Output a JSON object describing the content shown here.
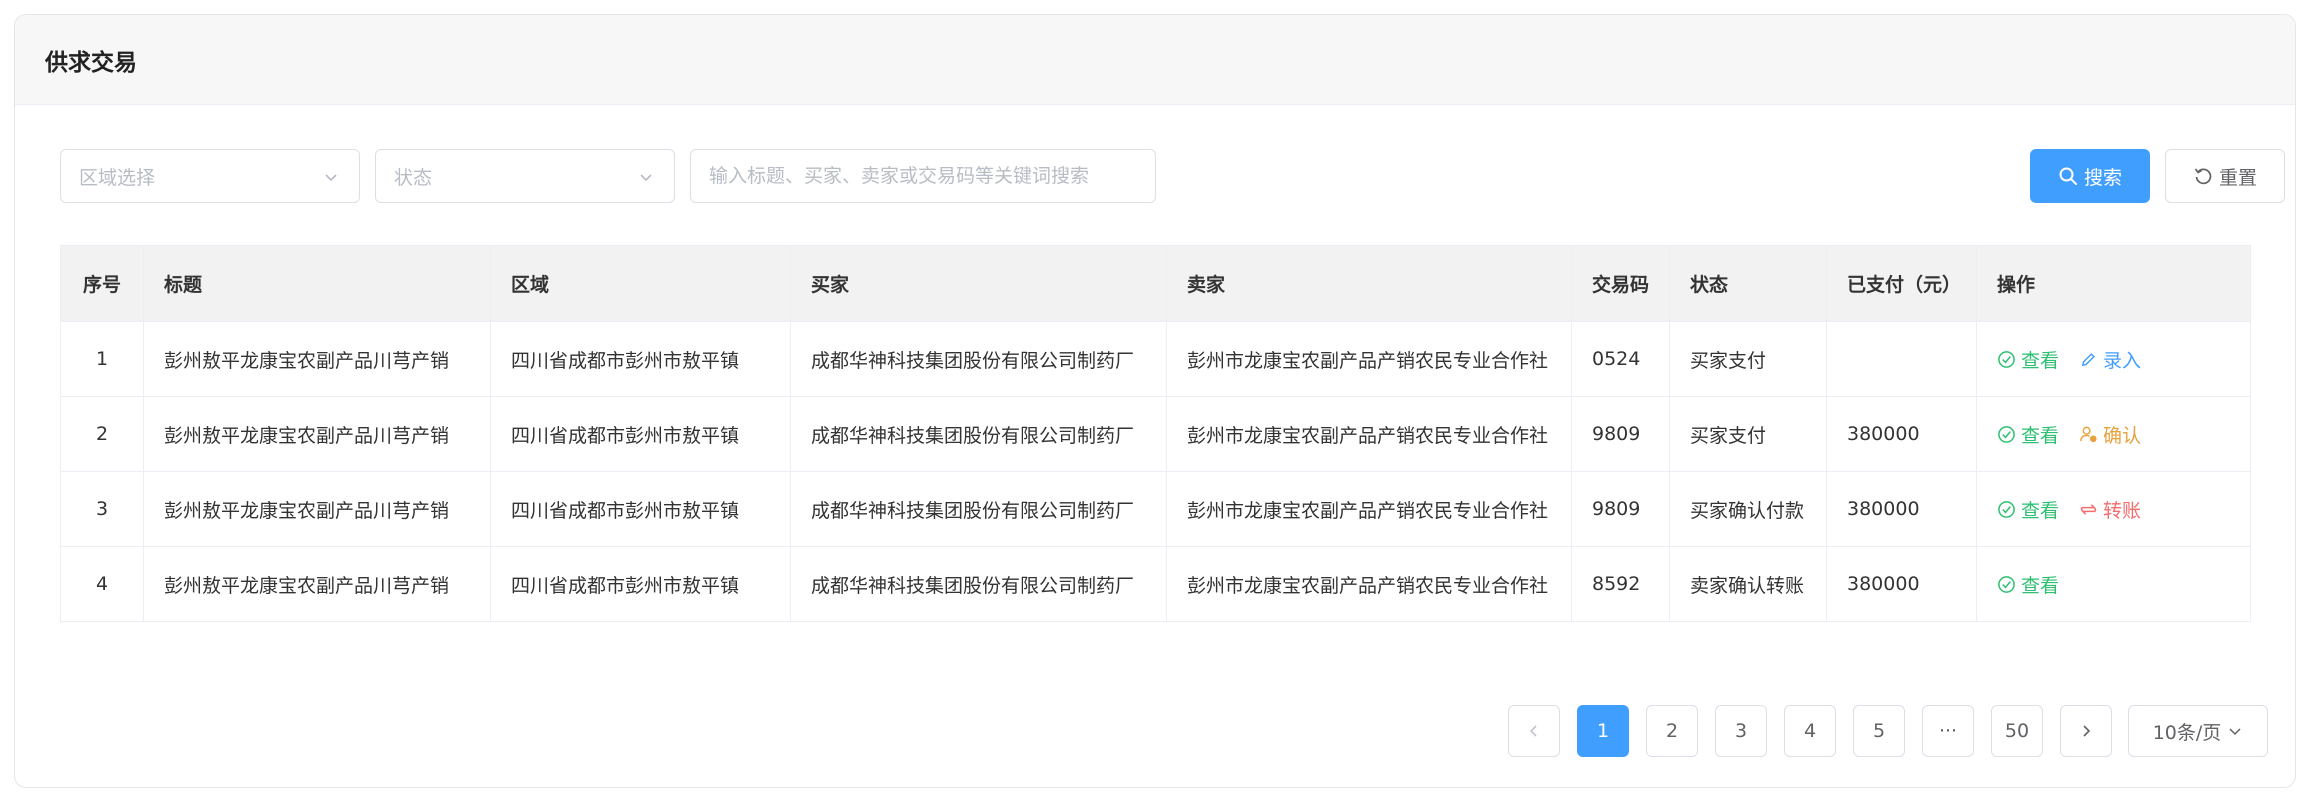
{
  "page": {
    "title": "供求交易"
  },
  "filters": {
    "region_placeholder": "区域选择",
    "status_placeholder": "状态",
    "keyword_placeholder": "输入标题、买家、卖家或交易码等关键词搜索",
    "search_label": "搜索",
    "reset_label": "重置"
  },
  "table": {
    "headers": {
      "index": "序号",
      "title": "标题",
      "region": "区域",
      "buyer": "买家",
      "seller": "卖家",
      "code": "交易码",
      "status": "状态",
      "paid": "已支付（元）",
      "ops": "操作"
    },
    "rows": [
      {
        "index": "1",
        "title": "彭州敖平龙康宝农副产品川芎产销",
        "region": "四川省成都市彭州市敖平镇",
        "buyer": "成都华神科技集团股份有限公司制药厂",
        "seller": "彭州市龙康宝农副产品产销农民专业合作社",
        "code": "0524",
        "status": "买家支付",
        "paid": "",
        "view": "查看",
        "action": "录入",
        "action_type": "edit"
      },
      {
        "index": "2",
        "title": "彭州敖平龙康宝农副产品川芎产销",
        "region": "四川省成都市彭州市敖平镇",
        "buyer": "成都华神科技集团股份有限公司制药厂",
        "seller": "彭州市龙康宝农副产品产销农民专业合作社",
        "code": "9809",
        "status": "买家支付",
        "paid": "380000",
        "view": "查看",
        "action": "确认",
        "action_type": "confirm"
      },
      {
        "index": "3",
        "title": "彭州敖平龙康宝农副产品川芎产销",
        "region": "四川省成都市彭州市敖平镇",
        "buyer": "成都华神科技集团股份有限公司制药厂",
        "seller": "彭州市龙康宝农副产品产销农民专业合作社",
        "code": "9809",
        "status": "买家确认付款",
        "paid": "380000",
        "view": "查看",
        "action": "转账",
        "action_type": "transfer"
      },
      {
        "index": "4",
        "title": "彭州敖平龙康宝农副产品川芎产销",
        "region": "四川省成都市彭州市敖平镇",
        "buyer": "成都华神科技集团股份有限公司制药厂",
        "seller": "彭州市龙康宝农副产品产销农民专业合作社",
        "code": "8592",
        "status": "卖家确认转账",
        "paid": "380000",
        "view": "查看",
        "action": "",
        "action_type": ""
      }
    ]
  },
  "pagination": {
    "pages": [
      "1",
      "2",
      "3",
      "4",
      "5"
    ],
    "current": "1",
    "ellipsis": "···",
    "last": "50",
    "page_size": "10条/页"
  },
  "colors": {
    "primary": "#409eff",
    "success": "#2fbf71",
    "warning": "#e6a23c",
    "danger": "#f56c6c"
  }
}
